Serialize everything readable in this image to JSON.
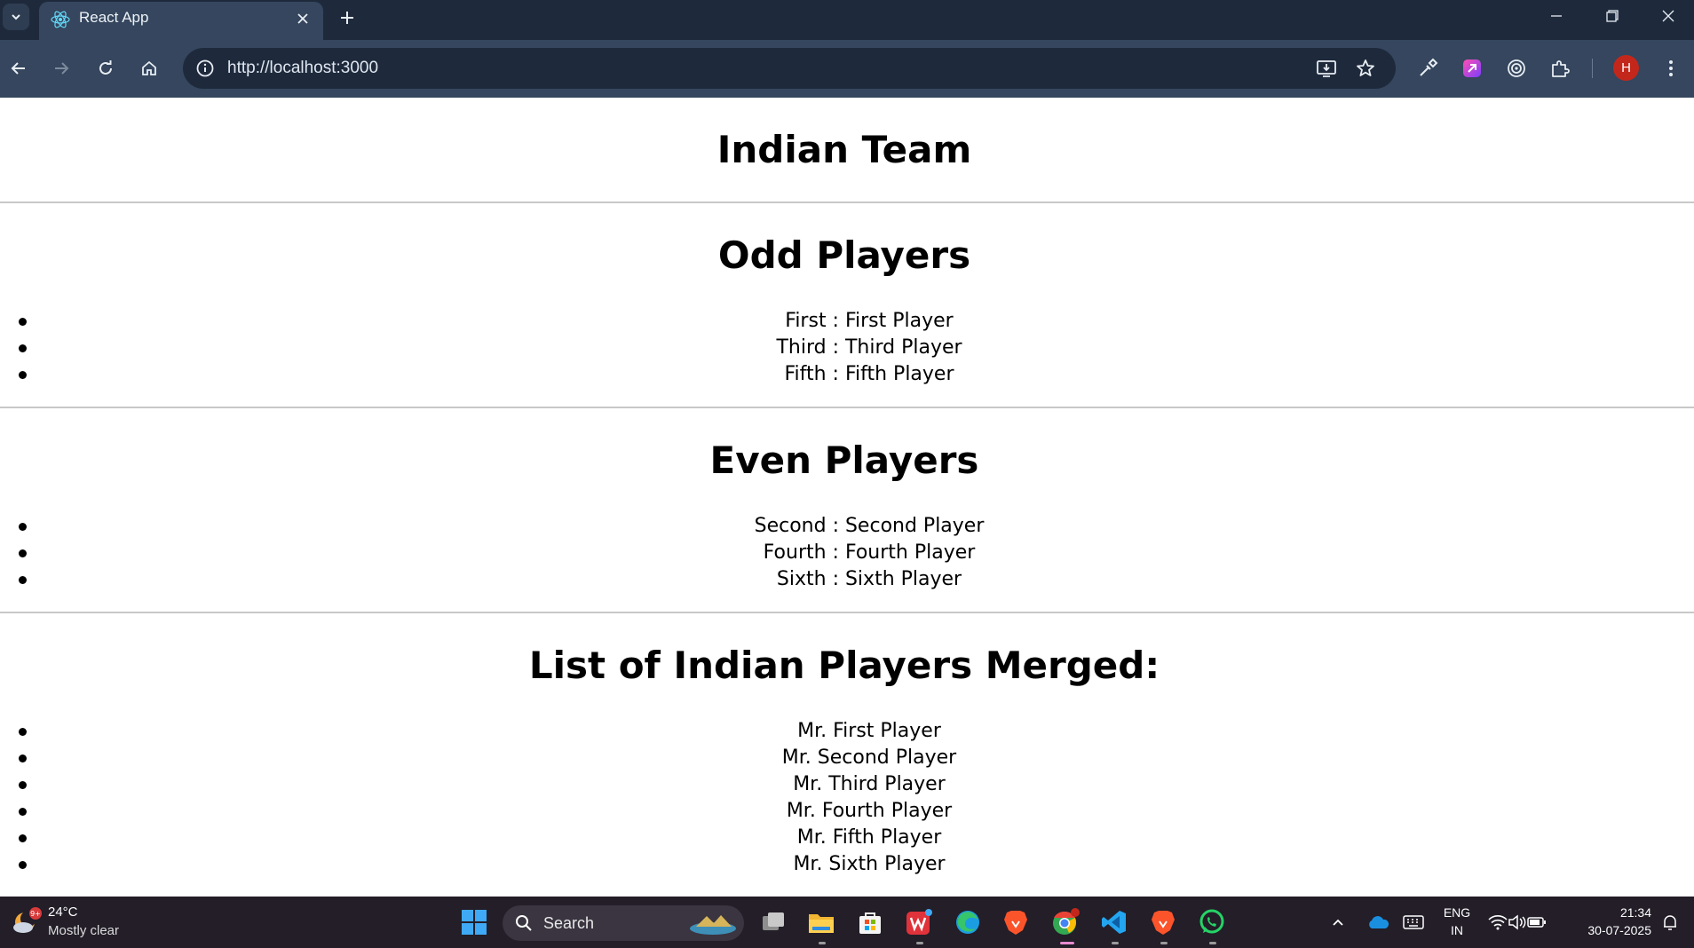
{
  "browser": {
    "tab_title": "React App",
    "url": "http://localhost:3000",
    "profile_initial": "H"
  },
  "page": {
    "title": "Indian Team",
    "odd_heading": "Odd Players",
    "odd_players": [
      "First : First Player",
      "Third : Third Player",
      "Fifth : Fifth Player"
    ],
    "even_heading": "Even Players",
    "even_players": [
      "Second : Second Player",
      "Fourth : Fourth Player",
      "Sixth : Sixth Player"
    ],
    "merged_heading": "List of Indian Players Merged:",
    "merged_players": [
      "Mr. First Player",
      "Mr. Second Player",
      "Mr. Third Player",
      "Mr. Fourth Player",
      "Mr. Fifth Player",
      "Mr. Sixth Player"
    ]
  },
  "taskbar": {
    "weather_badge": "9+",
    "temperature": "24°C",
    "condition": "Mostly clear",
    "search_label": "Search",
    "lang_top": "ENG",
    "lang_bottom": "IN",
    "time": "21:34",
    "date": "30-07-2025"
  },
  "colors": {
    "tabbar_bg": "#1e2a3c",
    "toolbar_bg": "#35465e",
    "taskbar_bg": "#231e28",
    "profile_red": "#c3271b"
  }
}
